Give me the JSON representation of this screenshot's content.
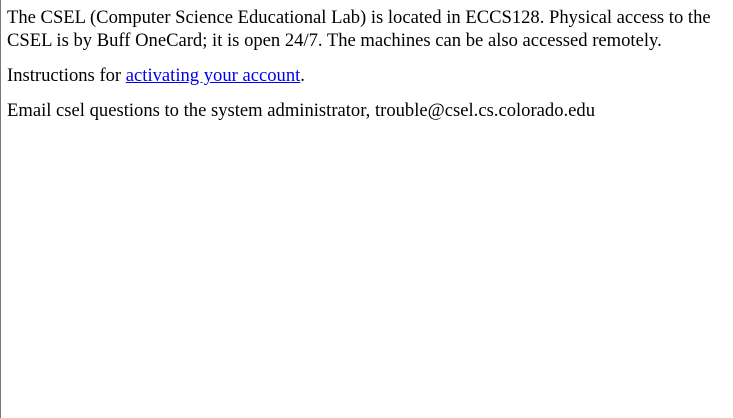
{
  "page": {
    "intro_text": "The CSEL (Computer Science Educational Lab) is located in ECCS128. Physical access to the CSEL is by Buff OneCard; it is open 24/7. The machines can be also accessed remotely.",
    "instructions_prefix": "Instructions for ",
    "instructions_link_label": "activating your account",
    "instructions_suffix": ".",
    "email_text": "Email csel questions to the system administrator, trouble@csel.cs.colorado.edu"
  },
  "colors": {
    "text": "#000000",
    "link": "#0000ee",
    "background": "#ffffff",
    "left_border": "#777777"
  }
}
